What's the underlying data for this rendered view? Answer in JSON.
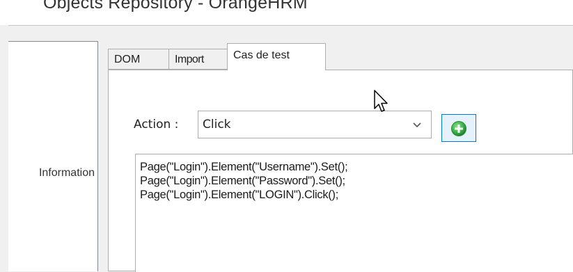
{
  "window": {
    "title": "Objects Repository - OrangeHRM"
  },
  "left_panel": {
    "label": "Information"
  },
  "tabs": [
    {
      "label": "DOM",
      "active": false
    },
    {
      "label": "Import",
      "active": false
    },
    {
      "label": "Cas de test",
      "active": true
    }
  ],
  "action": {
    "label": "Action :",
    "selected": "Click",
    "dropdown_icon": "chevron-down-icon",
    "add_icon": "green-plus-circle-icon"
  },
  "script": {
    "lines": [
      "Page(\"Login\").Element(\"Username\").Set();",
      "Page(\"Login\").Element(\"Password\").Set();",
      "Page(\"Login\").Element(\"LOGIN\").Click();"
    ]
  },
  "colors": {
    "add_button_border": "#0078d7",
    "add_button_bg": "#e5f1fb",
    "add_icon": "#3cb44a"
  }
}
